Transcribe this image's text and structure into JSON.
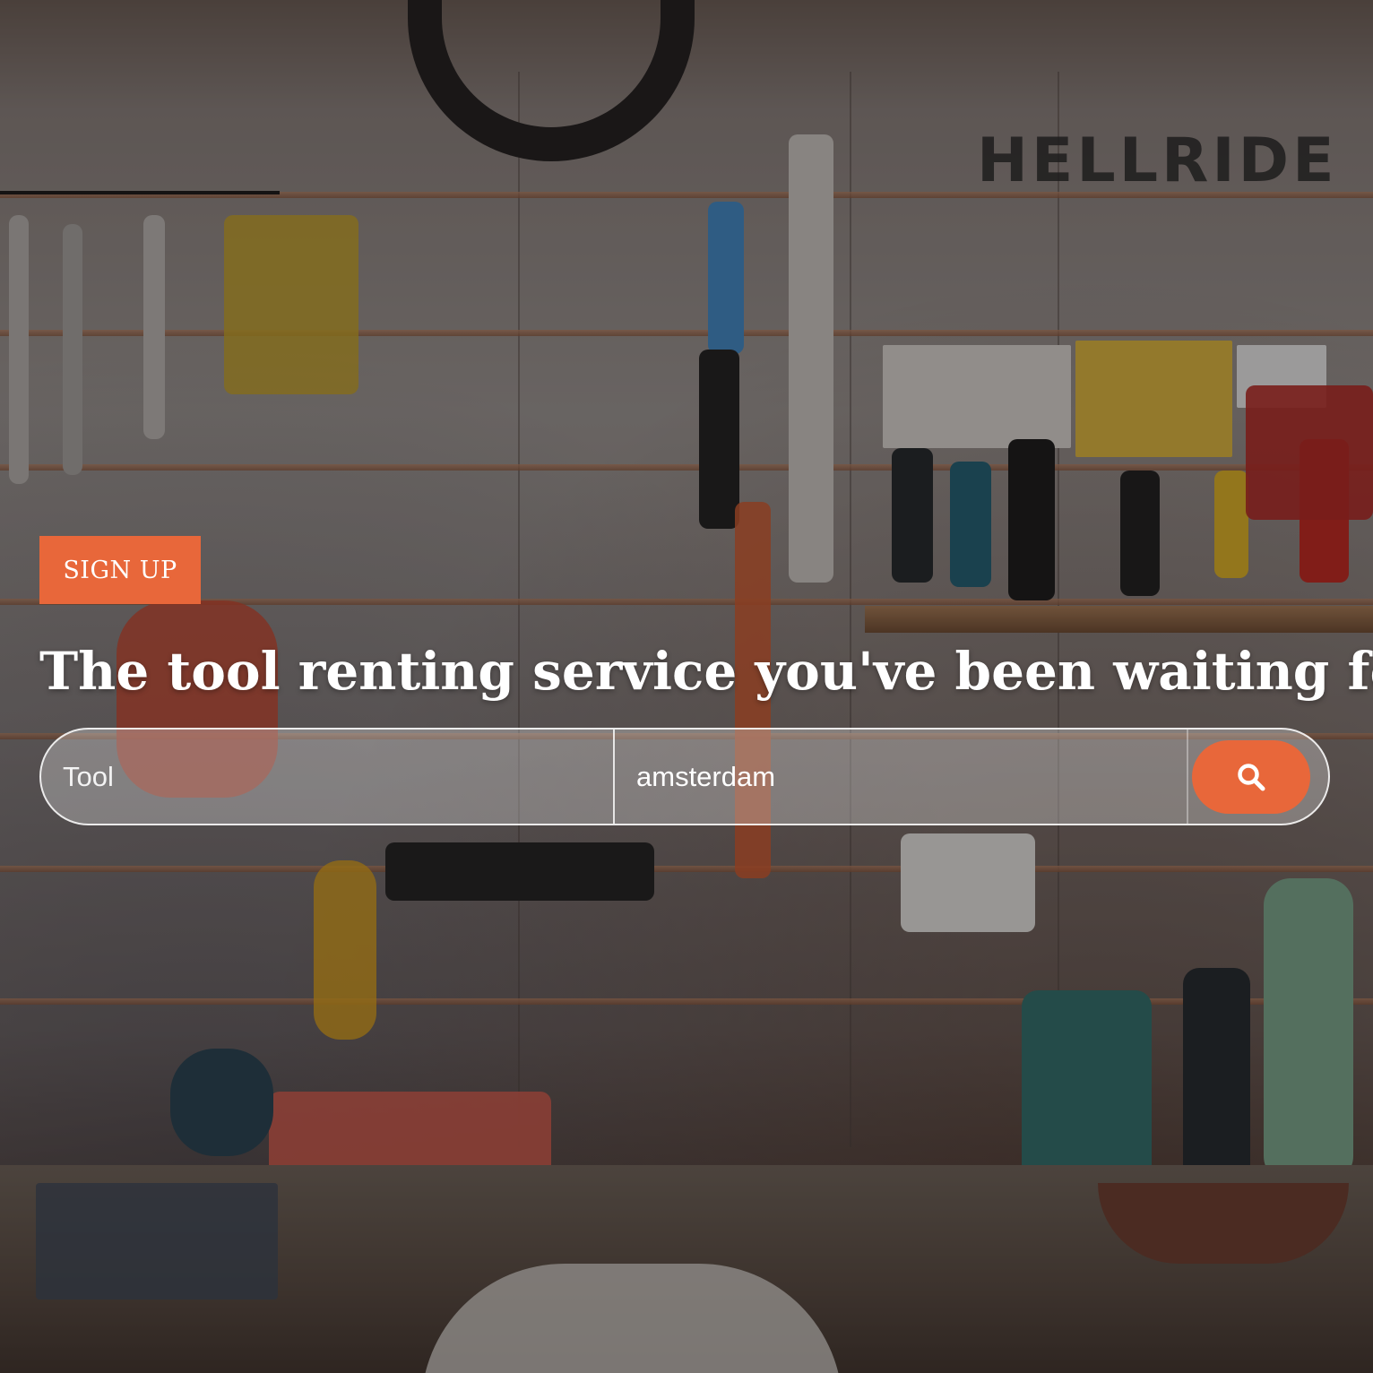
{
  "hero": {
    "signup_label": "SIGN UP",
    "headline": "The tool renting service you've been waiting for",
    "background_image": "workshop-wall-with-hanging-tools",
    "background_sign_text": "HELLRIDE"
  },
  "search": {
    "tool_placeholder": "Tool",
    "tool_value": "",
    "location_placeholder": "",
    "location_value": "amsterdam",
    "button_icon": "search-icon"
  },
  "colors": {
    "accent": "#e8673a",
    "text": "#ffffff",
    "search_bar_fill": "rgba(255,255,255,0.28)"
  }
}
